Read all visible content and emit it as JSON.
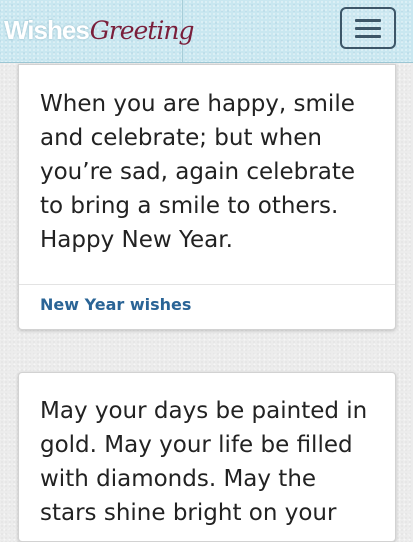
{
  "header": {
    "logo_part1": "Wishes",
    "logo_part2": "Greeting",
    "menu_icon": "hamburger-menu-icon"
  },
  "cards": [
    {
      "text": "When you are happy, smile and celebrate; but when you’re sad, again celebrate to bring a smile to others. Happy New Year.",
      "category": "New Year wishes"
    },
    {
      "text": "May your days be painted in gold. May your life be filled with diamonds. May the stars shine bright on your"
    }
  ],
  "colors": {
    "header_bg": "#c9e7f0",
    "logo_accent": "#7a1f3b",
    "link": "#2a6496",
    "text": "#222222"
  }
}
